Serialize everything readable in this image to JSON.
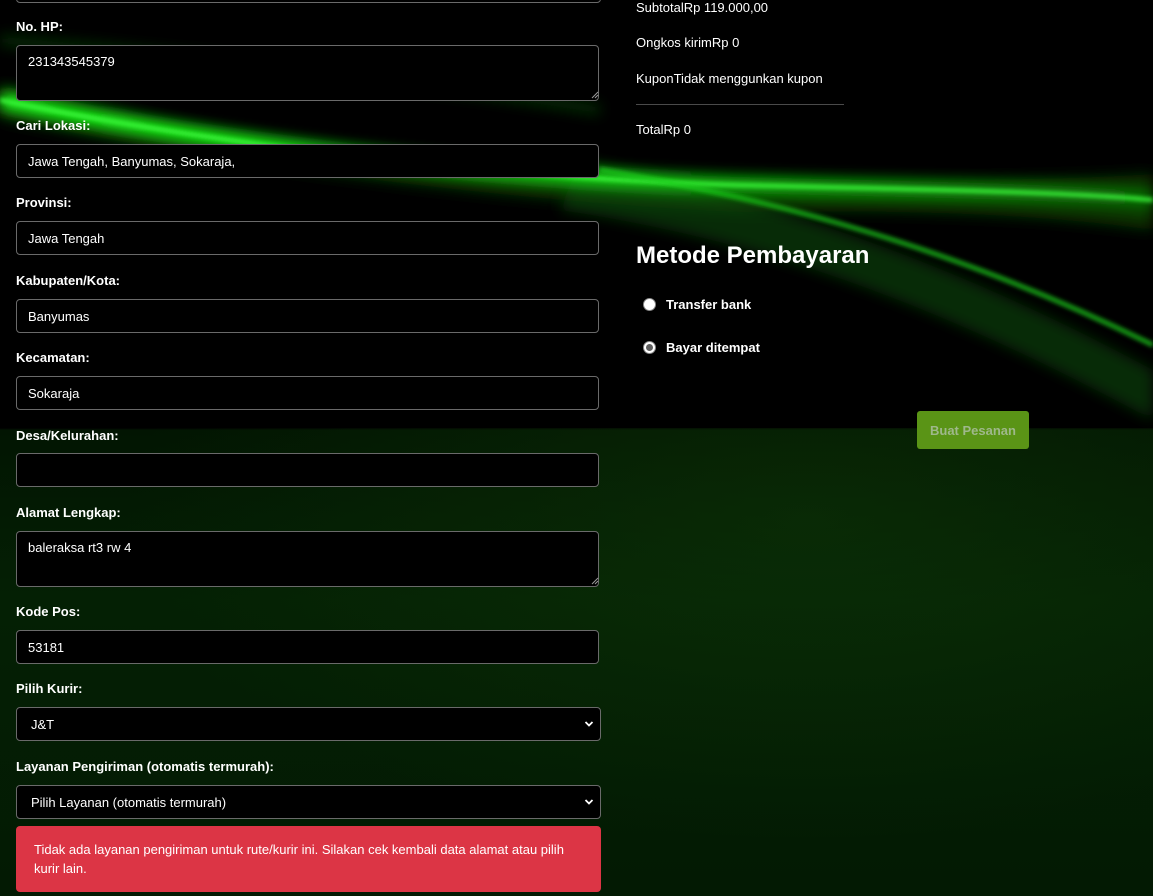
{
  "form": {
    "phone": {
      "label": "No. HP:",
      "value": "231343545379"
    },
    "search_location": {
      "label": "Cari Lokasi:",
      "value": "Jawa Tengah, Banyumas, Sokaraja,"
    },
    "province": {
      "label": "Provinsi:",
      "value": "Jawa Tengah"
    },
    "city": {
      "label": "Kabupaten/Kota:",
      "value": "Banyumas"
    },
    "district": {
      "label": "Kecamatan:",
      "value": "Sokaraja"
    },
    "village": {
      "label": "Desa/Kelurahan:",
      "value": ""
    },
    "address": {
      "label": "Alamat Lengkap:",
      "value": "baleraksa rt3 rw 4"
    },
    "postal_code": {
      "label": "Kode Pos:",
      "value": "53181"
    },
    "courier": {
      "label": "Pilih Kurir:",
      "selected": "J&T"
    },
    "shipping_service": {
      "label": "Layanan Pengiriman (otomatis termurah):",
      "selected": "Pilih Layanan (otomatis termurah)"
    },
    "alert": {
      "message": "Tidak ada layanan pengiriman untuk rute/kurir ini. Silakan cek kembali data alamat atau pilih kurir lain.",
      "color": "#dc3545"
    }
  },
  "summary": {
    "subtotal": "SubtotalRp 119.000,00",
    "shipping": "Ongkos kirimRp 0",
    "coupon": "KuponTidak menggunkan kupon",
    "total": "TotalRp 0"
  },
  "payment": {
    "heading": "Metode Pembayaran",
    "options": [
      {
        "label": "Transfer bank",
        "checked": false
      },
      {
        "label": "Bayar ditempat",
        "checked": true
      }
    ]
  },
  "order_button": {
    "label": "Buat Pesanan",
    "color": "#5a9416"
  },
  "icons": {
    "select_arrow": "chevron-down-icon",
    "resize": "resize-grip-icon"
  },
  "colors": {
    "background": "#000000",
    "accent_glow": "#23ff23",
    "alert": "#dc3545"
  }
}
